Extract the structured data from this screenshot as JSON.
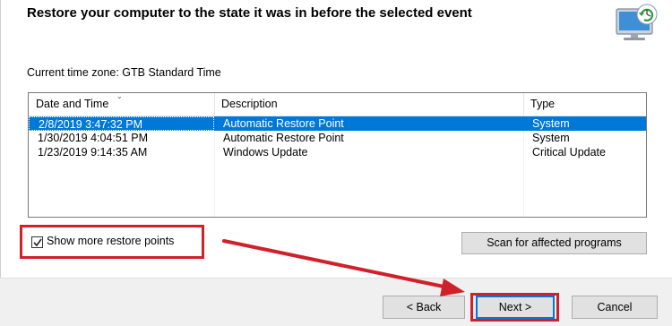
{
  "header": {
    "title": "Restore your computer to the state it was in before the selected event",
    "icon": "monitor-restore-icon"
  },
  "timezone": {
    "label": "Current time zone: GTB Standard Time"
  },
  "restore_list": {
    "columns": [
      "Date and Time",
      "Description",
      "Type"
    ],
    "rows": [
      {
        "date": "2/8/2019 3:47:32 PM",
        "description": "Automatic Restore Point",
        "type": "System",
        "selected": true
      },
      {
        "date": "1/30/2019 4:04:51 PM",
        "description": "Automatic Restore Point",
        "type": "System",
        "selected": false
      },
      {
        "date": "1/23/2019 9:14:35 AM",
        "description": "Windows Update",
        "type": "Critical Update",
        "selected": false
      }
    ]
  },
  "options": {
    "show_more_label": "Show more restore points",
    "show_more_checked": true,
    "scan_label": "Scan for affected programs"
  },
  "footer": {
    "back_label": "< Back",
    "next_label": "Next >",
    "cancel_label": "Cancel"
  },
  "colors": {
    "selection": "#0078d7",
    "highlight": "#d0202a",
    "button_face": "#e1e1e1"
  }
}
